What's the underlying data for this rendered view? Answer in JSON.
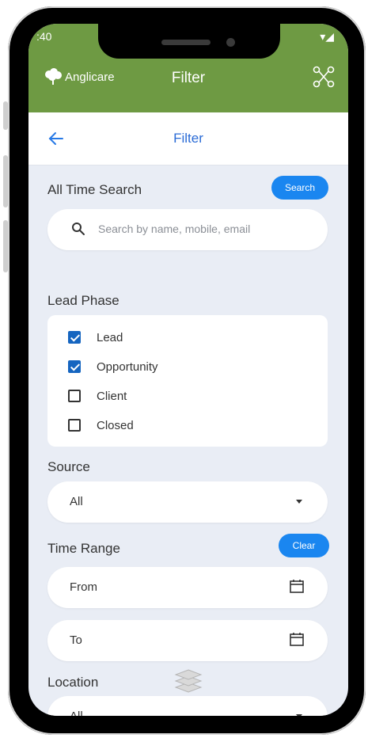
{
  "status": {
    "time": ":40",
    "right": "▾◢"
  },
  "appbar": {
    "brand": "Anglicare",
    "title": "Filter"
  },
  "subbar": {
    "title": "Filter"
  },
  "all_time_search": {
    "label": "All Time Search",
    "button": "Search",
    "placeholder": "Search by name, mobile, email"
  },
  "lead_phase": {
    "label": "Lead Phase",
    "options": [
      {
        "label": "Lead",
        "checked": true
      },
      {
        "label": "Opportunity",
        "checked": true
      },
      {
        "label": "Client",
        "checked": false
      },
      {
        "label": "Closed",
        "checked": false
      }
    ]
  },
  "source": {
    "label": "Source",
    "value": "All"
  },
  "time_range": {
    "label": "Time Range",
    "button": "Clear",
    "from": "From",
    "to": "To"
  },
  "location": {
    "label": "Location",
    "value": "All"
  },
  "colors": {
    "appbar": "#6e9a43",
    "accent": "#1a86f0",
    "background": "#e9edf5"
  }
}
